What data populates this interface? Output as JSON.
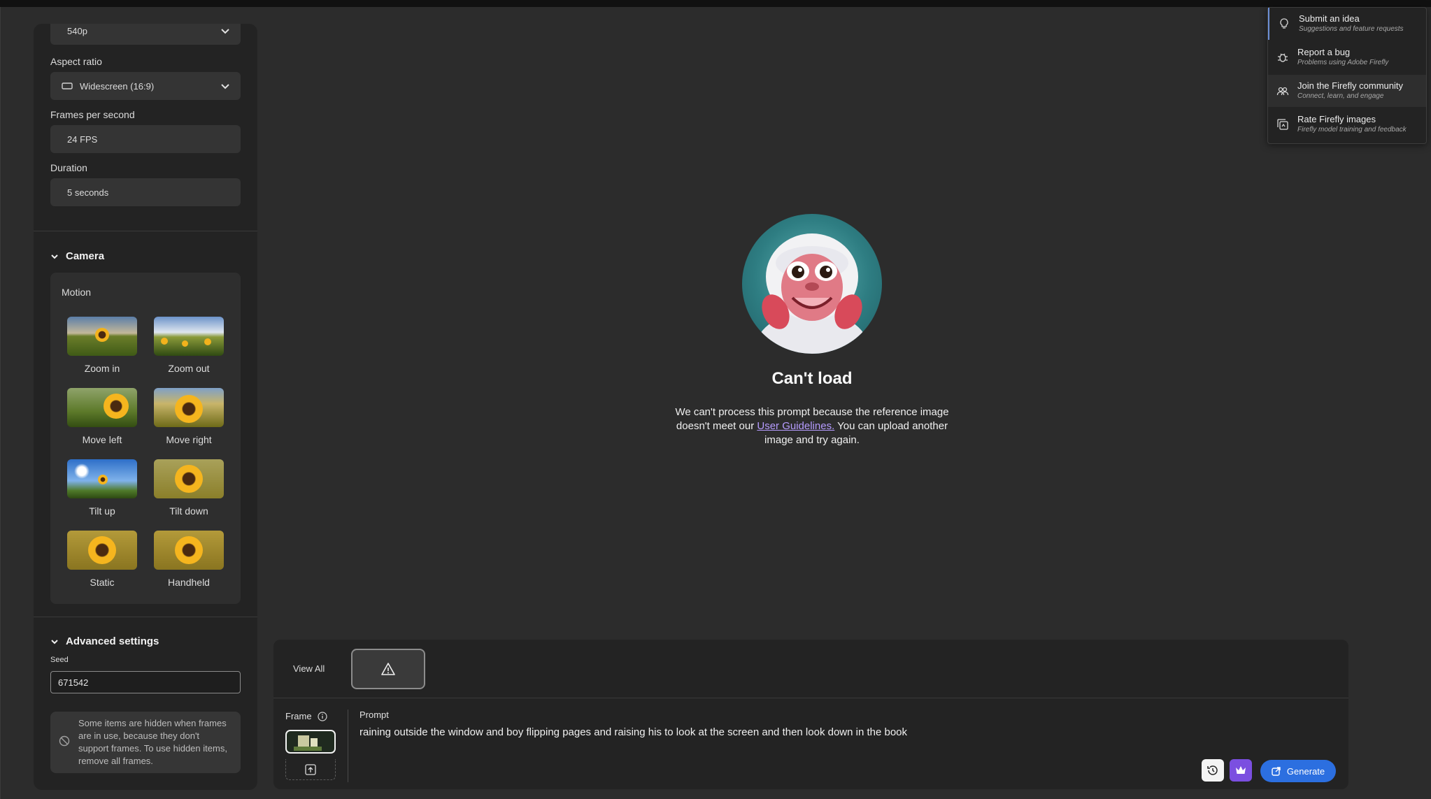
{
  "left_panel": {
    "resolution_value": "540p",
    "aspect_ratio_label": "Aspect ratio",
    "aspect_ratio_value": "Widescreen (16:9)",
    "fps_label": "Frames per second",
    "fps_value": "24 FPS",
    "duration_label": "Duration",
    "duration_value": "5 seconds",
    "camera_title": "Camera",
    "motion_label": "Motion",
    "motions": [
      {
        "label": "Zoom in"
      },
      {
        "label": "Zoom out"
      },
      {
        "label": "Move left"
      },
      {
        "label": "Move right"
      },
      {
        "label": "Tilt up"
      },
      {
        "label": "Tilt down"
      },
      {
        "label": "Static"
      },
      {
        "label": "Handheld"
      }
    ],
    "advanced_title": "Advanced settings",
    "seed_label": "Seed",
    "seed_value": "671542",
    "hidden_note": "Some items are hidden when frames are in use, because they don't support frames. To use hidden items, remove all frames."
  },
  "center": {
    "title": "Can't load",
    "message_pre": "We can't process this prompt because the reference image doesn't meet our ",
    "message_link": "User Guidelines.",
    "message_post": " You can upload another image and try again."
  },
  "feedback_menu": [
    {
      "title": "Submit an idea",
      "subtitle": "Suggestions and feature requests",
      "icon": "lightbulb-icon"
    },
    {
      "title": "Report a bug",
      "subtitle": "Problems using Adobe Firefly",
      "icon": "bug-icon"
    },
    {
      "title": "Join the Firefly community",
      "subtitle": "Connect, learn, and engage",
      "icon": "community-icon"
    },
    {
      "title": "Rate Firefly images",
      "subtitle": "Firefly model training and feedback",
      "icon": "rate-images-icon"
    }
  ],
  "prompt_panel": {
    "view_all": "View All",
    "frame_label": "Frame",
    "prompt_label": "Prompt",
    "prompt_text": "raining outside the window and boy flipping pages and raising his to look at the screen and then look down in the book",
    "generate_label": "Generate"
  },
  "colors": {
    "accent": "#2c6fe0",
    "premium": "#7b4fe0",
    "link": "#b69cff"
  }
}
